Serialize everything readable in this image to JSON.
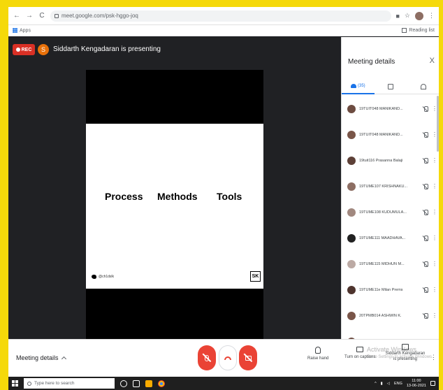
{
  "browser": {
    "url": "meet.google.com/psk-hggo-joq",
    "bookmarks_apps": "Apps",
    "reading_list": "Reading list"
  },
  "meet": {
    "rec_label": "REC",
    "presenter_initial": "S",
    "presenting_text": "Siddarth Kengadaran is presenting"
  },
  "slide": {
    "words": [
      "Process",
      "Methods",
      "Tools"
    ],
    "twitter_handle": "@ch1dslk",
    "logo": "SK"
  },
  "panel": {
    "title": "Meeting details",
    "close": "X",
    "people_count": "(35)",
    "participants": [
      {
        "name": "19TUIT048 MANIKAND...",
        "color": "#6d4c41"
      },
      {
        "name": "19TUIT048 MANIKAND...",
        "color": "#795548"
      },
      {
        "name": "19tuit116 Prasanna Balaji",
        "color": "#5d4037"
      },
      {
        "name": "19TUME107 KRISHNAKU...",
        "color": "#8d6e63"
      },
      {
        "name": "19TUME108 KUDUMULA...",
        "color": "#a1887f"
      },
      {
        "name": "19TUME111 MAADHAVA...",
        "color": "#212121"
      },
      {
        "name": "19TUME115 MIDHUN M...",
        "color": "#bcaaa4"
      },
      {
        "name": "19TUME11e Milan Prems",
        "color": "#4e342e"
      },
      {
        "name": "20TPMB014 ASHWIN K.",
        "color": "#795548"
      },
      {
        "name": "20TPMB050 MEGALA T...",
        "color": "#6d4c41"
      }
    ]
  },
  "controls": {
    "meeting_details": "Meeting details",
    "raise_hand": "Raise hand",
    "turn_on_captions": "Turn on captions",
    "presenter_tile_line1": "Siddarth Kengadaran",
    "presenter_tile_line2": "is presenting",
    "watermark_title": "Activate Windows",
    "watermark_sub": "Go to Settings to activate Windows."
  },
  "taskbar": {
    "search_placeholder": "Type here to search",
    "lang": "ENG",
    "time": "11:00",
    "date": "13-06-2021"
  }
}
